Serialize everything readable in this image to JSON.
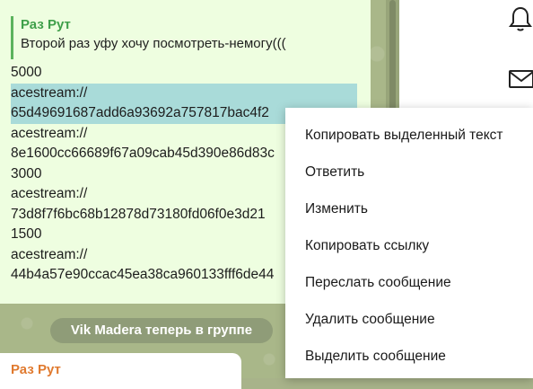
{
  "message": {
    "reply_author": "Раз Рут",
    "reply_text": "Второй раз уфу хочу посмотреть-немогу(((",
    "lines": [
      "5000",
      "acestream://",
      "65d49691687add6a93692a757817bac4f2",
      "acestream://",
      "8e1600cc66689f67a09cab45d390e86d83c",
      "3000",
      "acestream://",
      "73d8f7f6bc68b12878d73180fd06f0e3d21",
      "1500",
      "acestream://",
      "44b4a57e90ccac45ea38ca960133fff6de44"
    ],
    "selected_fragment_tail": "…"
  },
  "service_message": "Vik Madera теперь в группе",
  "next_message": {
    "author": "Раз Рут"
  },
  "context_menu": {
    "items": [
      "Копировать выделенный текст",
      "Ответить",
      "Изменить",
      "Копировать ссылку",
      "Переслать сообщение",
      "Удалить сообщение",
      "Выделить сообщение"
    ]
  },
  "icons": {
    "settings": "gear-icon",
    "notifications": "bell-icon",
    "messages": "mail-icon"
  },
  "colors": {
    "outgoing_bubble": "#eefee0",
    "selection": "#a9dbd9",
    "reply_accent": "#3f9f4a",
    "author_orange": "#e07a2f",
    "chat_background": "#a9b789"
  }
}
